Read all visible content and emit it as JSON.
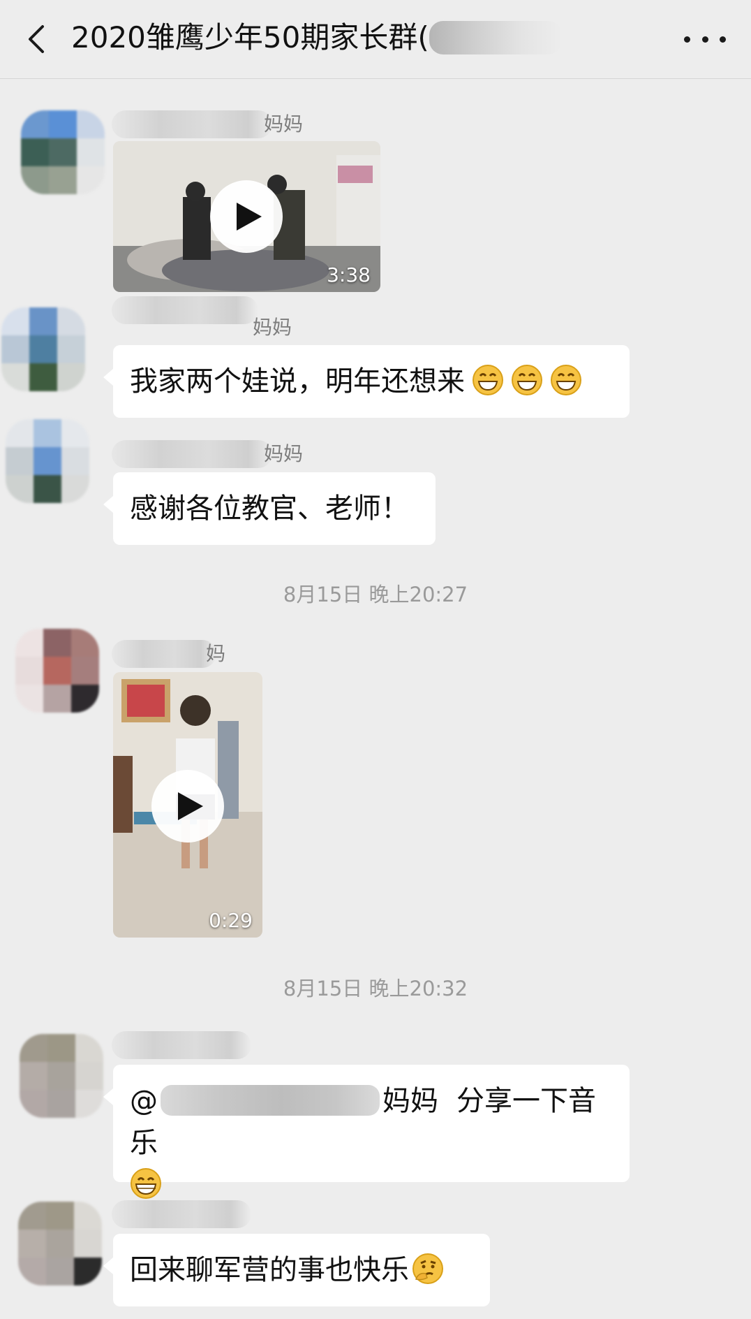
{
  "header": {
    "title": "2020雏鹰少年50期家长群(",
    "back_icon": "chevron-left-icon",
    "more_icon": "more-dots-icon"
  },
  "messages": [
    {
      "type": "video",
      "nickname_suffix": "妈妈",
      "duration": "3:38"
    },
    {
      "type": "text",
      "nickname_suffix": "妈妈",
      "text": "我家两个娃说，明年还想来",
      "emojis": [
        "grin-emoji",
        "grin-emoji",
        "grin-emoji"
      ]
    },
    {
      "type": "text",
      "nickname_suffix": "妈妈",
      "text": "感谢各位教官、老师！"
    },
    {
      "type": "timestamp",
      "text": "8月15日 晚上20:27"
    },
    {
      "type": "video",
      "nickname_suffix": "妈",
      "duration": "0:29"
    },
    {
      "type": "timestamp",
      "text": "8月15日 晚上20:32"
    },
    {
      "type": "text",
      "mention_prefix": "@",
      "mention_suffix": "妈妈",
      "text": "分享一下音乐",
      "emojis": [
        "big-grin-emoji"
      ]
    },
    {
      "type": "text",
      "text": "回来聊军营的事也快乐",
      "emojis": [
        "thinking-emoji"
      ]
    }
  ]
}
